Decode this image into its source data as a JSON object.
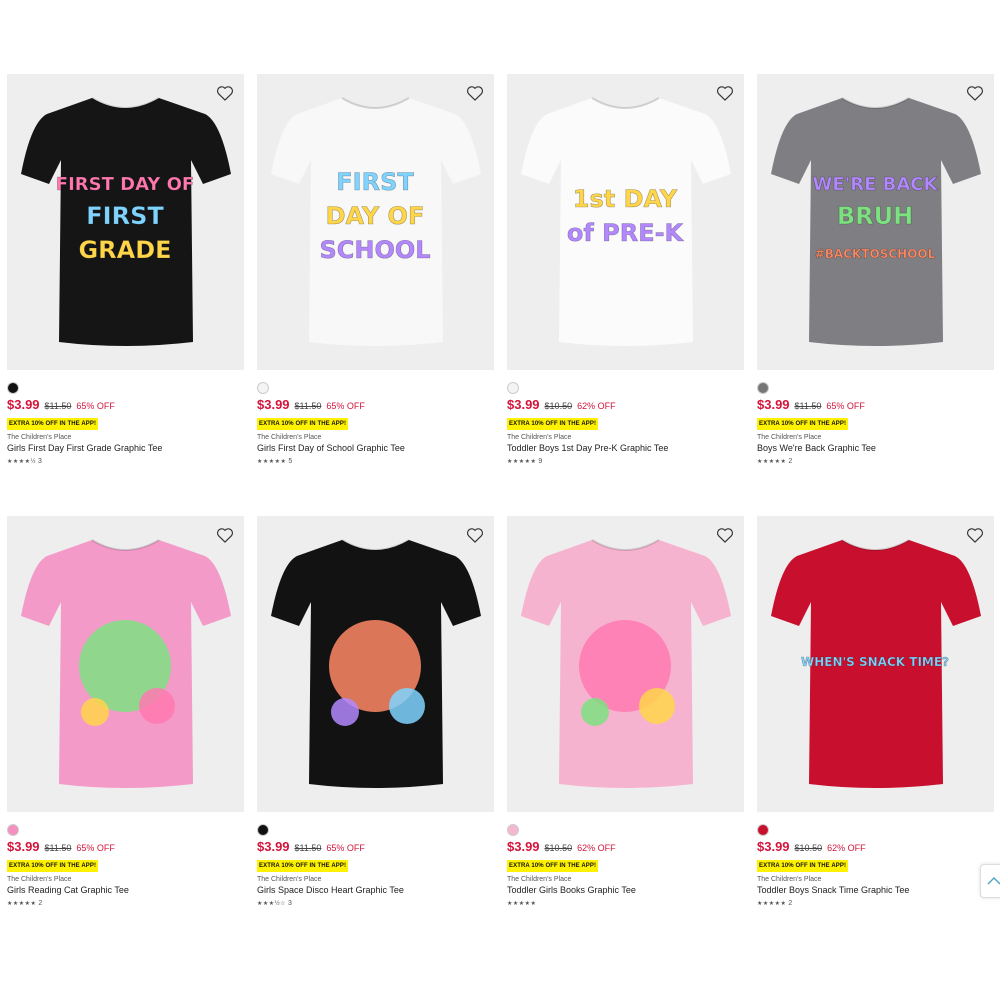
{
  "products": [
    {
      "shirt_color": "#151515",
      "swatch_color": "#111111",
      "art_lines": [
        "FIRST DAY OF",
        "FIRST",
        "GRADE"
      ],
      "price": "$3.99",
      "original_price": "$11.50",
      "discount": "65% OFF",
      "promo": "EXTRA 10% OFF IN THE APP!",
      "brand": "The Children's Place",
      "title": "Girls First Day First Grade Graphic Tee",
      "stars": "★★★★½",
      "review_count": "3",
      "favorite_icon": "heart-outline-icon"
    },
    {
      "shirt_color": "#f8f8f8",
      "swatch_color": "#f4f4f4",
      "art_lines": [
        "FIRST",
        "DAY OF",
        "SCHOOL"
      ],
      "price": "$3.99",
      "original_price": "$11.50",
      "discount": "65% OFF",
      "promo": "EXTRA 10% OFF IN THE APP!",
      "brand": "The Children's Place",
      "title": "Girls First Day of School Graphic Tee",
      "stars": "★★★★★",
      "review_count": "5",
      "favorite_icon": "heart-outline-icon"
    },
    {
      "shirt_color": "#fbfbfb",
      "swatch_color": "#f4f4f4",
      "art_lines": [
        "1st DAY",
        "of PRE-K"
      ],
      "price": "$3.99",
      "original_price": "$10.50",
      "discount": "62% OFF",
      "promo": "EXTRA 10% OFF IN THE APP!",
      "brand": "The Children's Place",
      "title": "Toddler Boys 1st Day Pre-K Graphic Tee",
      "stars": "★★★★★",
      "review_count": "9",
      "favorite_icon": "heart-outline-icon"
    },
    {
      "shirt_color": "#7f7f83",
      "swatch_color": "#777777",
      "art_lines": [
        "WE'RE BACK",
        "BRUH",
        "#BACKTOSCHOOL"
      ],
      "price": "$3.99",
      "original_price": "$11.50",
      "discount": "65% OFF",
      "promo": "EXTRA 10% OFF IN THE APP!",
      "brand": "The Children's Place",
      "title": "Boys We're Back Graphic Tee",
      "stars": "★★★★★",
      "review_count": "2",
      "favorite_icon": "heart-outline-icon"
    },
    {
      "shirt_color": "#f39ac8",
      "swatch_color": "#f48fc0",
      "art_lines": [],
      "price": "$3.99",
      "original_price": "$11.50",
      "discount": "65% OFF",
      "promo": "EXTRA 10% OFF IN THE APP!",
      "brand": "The Children's Place",
      "title": "Girls Reading Cat Graphic Tee",
      "stars": "★★★★★",
      "review_count": "2",
      "favorite_icon": "heart-outline-icon"
    },
    {
      "shirt_color": "#121212",
      "swatch_color": "#111111",
      "art_lines": [],
      "price": "$3.99",
      "original_price": "$11.50",
      "discount": "65% OFF",
      "promo": "EXTRA 10% OFF IN THE APP!",
      "brand": "The Children's Place",
      "title": "Girls Space Disco Heart Graphic Tee",
      "stars": "★★★½☆",
      "review_count": "3",
      "favorite_icon": "heart-outline-icon"
    },
    {
      "shirt_color": "#f6b3cf",
      "swatch_color": "#f6b8d0",
      "art_lines": [],
      "price": "$3.99",
      "original_price": "$10.50",
      "discount": "62% OFF",
      "promo": "EXTRA 10% OFF IN THE APP!",
      "brand": "The Children's Place",
      "title": "Toddler Girls Books Graphic Tee",
      "stars": "★★★★★",
      "review_count": "",
      "favorite_icon": "heart-outline-icon"
    },
    {
      "shirt_color": "#c8102e",
      "swatch_color": "#c8102e",
      "art_lines": [
        "WHEN'S SNACK TIME?"
      ],
      "price": "$3.99",
      "original_price": "$10.50",
      "discount": "62% OFF",
      "promo": "EXTRA 10% OFF IN THE APP!",
      "brand": "The Children's Place",
      "title": "Toddler Boys Snack Time Graphic Tee",
      "stars": "★★★★★",
      "review_count": "2",
      "favorite_icon": "heart-outline-icon"
    }
  ],
  "scroll_top_icon": "chevron-up-icon"
}
